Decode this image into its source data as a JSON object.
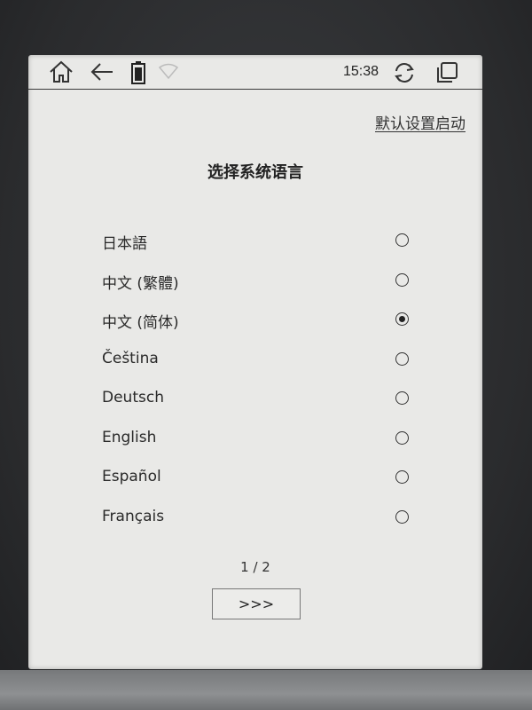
{
  "status_bar": {
    "time": "15:38",
    "icons": [
      "home-icon",
      "back-icon",
      "battery-icon",
      "wifi-icon",
      "refresh-icon",
      "multitask-icon"
    ]
  },
  "header": {
    "default_settings_link": "默认设置启动"
  },
  "page": {
    "title": "选择系统语言"
  },
  "languages": [
    {
      "label": "日本語",
      "selected": false
    },
    {
      "label": "中文 (繁體)",
      "selected": false
    },
    {
      "label": "中文 (简体)",
      "selected": true
    },
    {
      "label": "Čeština",
      "selected": false
    },
    {
      "label": "Deutsch",
      "selected": false
    },
    {
      "label": "English",
      "selected": false
    },
    {
      "label": "Español",
      "selected": false
    },
    {
      "label": "Français",
      "selected": false
    }
  ],
  "pagination": {
    "indicator": "1 / 2",
    "next_label": ">>>"
  }
}
